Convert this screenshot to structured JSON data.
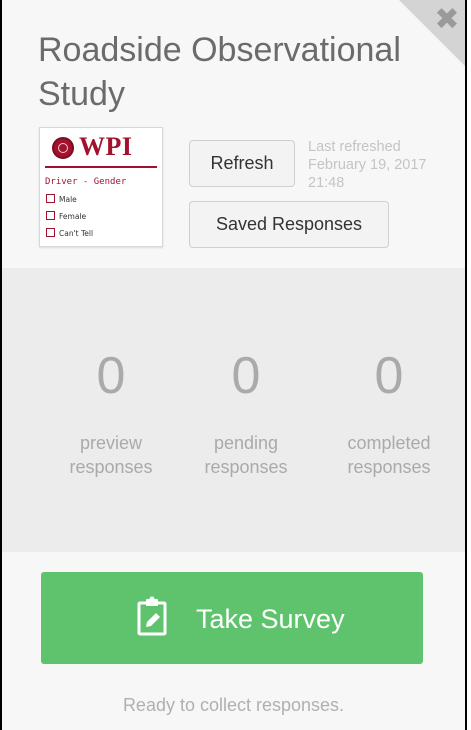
{
  "title": "Roadside Observational Study",
  "thumbnail": {
    "logo_text": "WPI",
    "question": "Driver - Gender",
    "options": [
      "Male",
      "Female",
      "Can't Tell"
    ]
  },
  "buttons": {
    "refresh": "Refresh",
    "saved_responses": "Saved Responses"
  },
  "last_refreshed": {
    "label": "Last refreshed",
    "date": "February 19, 2017",
    "time": "21:48"
  },
  "stats": [
    {
      "value": "0",
      "label_line1": "preview",
      "label_line2": "responses"
    },
    {
      "value": "0",
      "label_line1": "pending",
      "label_line2": "responses"
    },
    {
      "value": "0",
      "label_line1": "completed",
      "label_line2": "responses"
    }
  ],
  "take_survey": {
    "label": "Take Survey",
    "icon": "clipboard-edit-icon"
  },
  "status_text": "Ready to collect responses.",
  "colors": {
    "accent_green": "#5fc36e",
    "wpi_red": "#a3122d"
  }
}
